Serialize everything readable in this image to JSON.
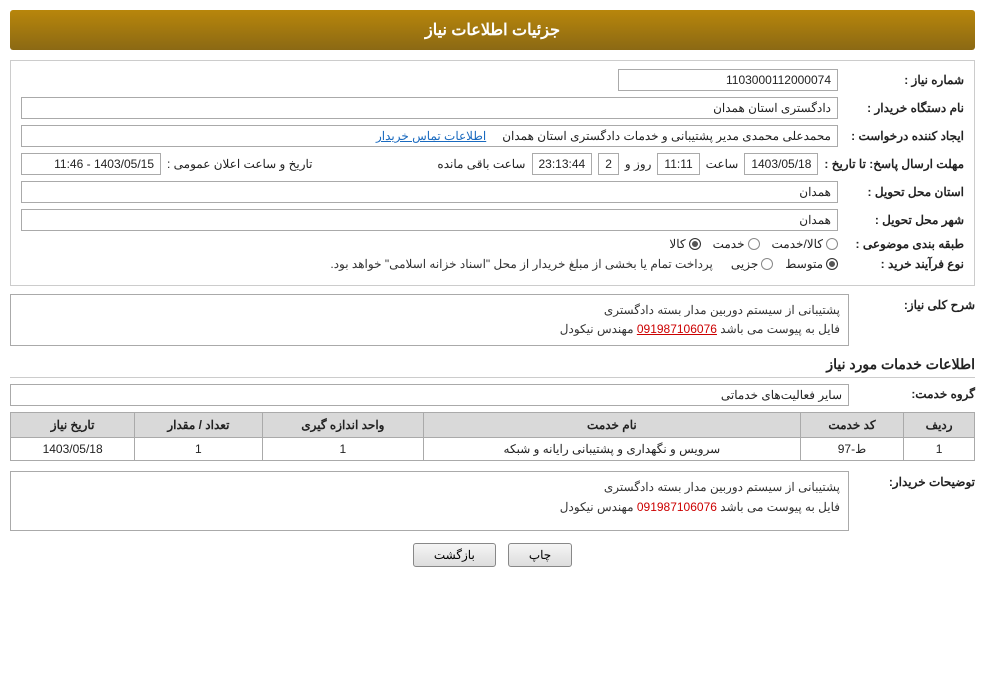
{
  "header": {
    "title": "جزئیات اطلاعات نیاز"
  },
  "fields": {
    "need_number_label": "شماره نیاز :",
    "need_number_value": "1103000112000074",
    "requester_org_label": "نام دستگاه خریدار :",
    "requester_org_value": "دادگستری استان همدان",
    "creator_label": "ایجاد کننده درخواست :",
    "creator_value": "محمدعلی محمدی مدیر پشتیبانی و خدمات دادگستری استان همدان",
    "creator_link": "اطلاعات تماس خریدار",
    "send_deadline_label": "مهلت ارسال پاسخ: تا تاریخ :",
    "send_date": "1403/05/18",
    "send_time_label": "ساعت",
    "send_time": "11:11",
    "send_day_label": "روز و",
    "send_days": "2",
    "send_remaining_label": "ساعت باقی مانده",
    "send_remaining": "23:13:44",
    "public_announce_label": "تاریخ و ساعت اعلان عمومی :",
    "public_announce_value": "1403/05/15 - 11:46",
    "province_label": "استان محل تحویل :",
    "province_value": "همدان",
    "city_label": "شهر محل تحویل :",
    "city_value": "همدان",
    "category_label": "طبقه بندی موضوعی :",
    "radio_kala": "کالا",
    "radio_khedmat": "خدمت",
    "radio_kala_khedmat": "کالا/خدمت",
    "purchase_type_label": "نوع فرآیند خرید :",
    "radio_jozi": "جزیی",
    "radio_mottaset": "متوسط",
    "radio_description": "پرداخت تمام یا بخشی از مبلغ خریدار از محل \"اسناد خزانه اسلامی\" خواهد بود."
  },
  "description_section": {
    "title": "شرح کلی نیاز:",
    "line1": "پشتیبانی از سیستم دوربین مدار بسته  دادگستری",
    "line2_prefix": "فایل به پیوست می باشد",
    "line2_number": "091987106076",
    "line2_suffix": "مهندس نیکودل"
  },
  "service_info": {
    "title": "اطلاعات خدمات مورد نیاز",
    "group_label": "گروه خدمت:",
    "group_value": "سایر فعالیت‌های خدماتی",
    "table": {
      "headers": [
        "ردیف",
        "کد خدمت",
        "نام خدمت",
        "واحد اندازه گیری",
        "تعداد / مقدار",
        "تاریخ نیاز"
      ],
      "rows": [
        [
          "1",
          "ط-97",
          "سرویس و نگهداری و پشتیبانی رایانه و شبکه",
          "1",
          "1",
          "1403/05/18"
        ]
      ]
    }
  },
  "buyer_description": {
    "label": "توضیحات خریدار:",
    "line1": "پشتیبانی از سیستم دوربین  مدار بسته  دادگستری",
    "line2_prefix": "فایل به پیوست می باشد",
    "line2_number": "091987106076",
    "line2_suffix": "مهندس نیکودل"
  },
  "buttons": {
    "back": "بازگشت",
    "print": "چاپ"
  }
}
